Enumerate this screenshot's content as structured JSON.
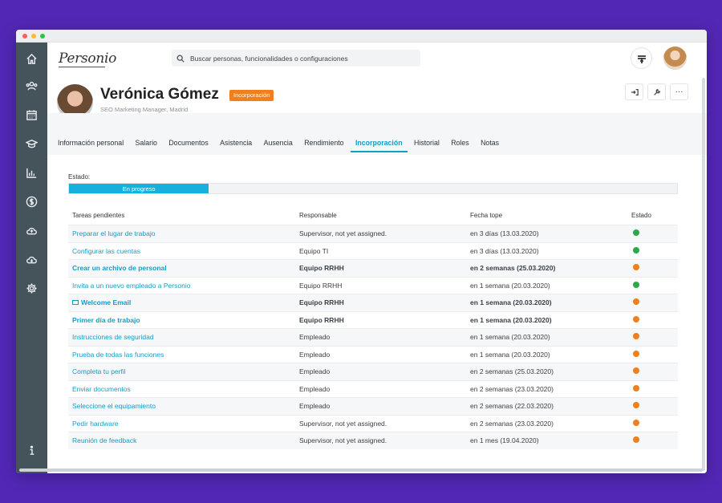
{
  "colors": {
    "background": "#5227b5",
    "sidebar": "#45535b",
    "accent": "#139ec6",
    "badge": "#f07f1e",
    "status_done": "#2aa84a",
    "status_pending": "#f07f1e"
  },
  "sidebar": {
    "items": [
      {
        "icon": "home-icon"
      },
      {
        "icon": "people-icon"
      },
      {
        "icon": "calendar-icon"
      },
      {
        "icon": "graduation-cap-icon"
      },
      {
        "icon": "bar-chart-icon"
      },
      {
        "icon": "dollar-icon"
      },
      {
        "icon": "cloud-upload-icon"
      },
      {
        "icon": "cloud-download-icon"
      },
      {
        "icon": "gear-icon"
      },
      {
        "icon": "info-icon"
      }
    ]
  },
  "header": {
    "logo": "Personio",
    "search_placeholder": "Buscar personas, funcionalidades o configuraciones"
  },
  "profile": {
    "name": "Verónica Gómez",
    "badge": "Incorporación",
    "subtitle": "SEO Marketing Manager, Madrid",
    "more_label": "···"
  },
  "tabs": [
    {
      "label": "Información personal",
      "active": false
    },
    {
      "label": "Salario",
      "active": false
    },
    {
      "label": "Documentos",
      "active": false
    },
    {
      "label": "Asistencia",
      "active": false
    },
    {
      "label": "Ausencia",
      "active": false
    },
    {
      "label": "Rendimiento",
      "active": false
    },
    {
      "label": "Incorporación",
      "active": true
    },
    {
      "label": "Historial",
      "active": false
    },
    {
      "label": "Roles",
      "active": false
    },
    {
      "label": "Notas",
      "active": false
    }
  ],
  "onboarding": {
    "estado_label": "Estado:",
    "progress_label": "En progreso",
    "progress_fraction": 0.23,
    "columns": [
      "Tareas pendientes",
      "Responsable",
      "Fecha tope",
      "Estado"
    ],
    "rows": [
      {
        "task": "Preparar el lugar de trabajo",
        "owner": "Supervisor, not yet assigned.",
        "due": "en 3 días (13.03.2020)",
        "status": "done",
        "bold": false,
        "icon": ""
      },
      {
        "task": "Configurar las cuentas",
        "owner": "Equipo TI",
        "due": "en 3 días (13.03.2020)",
        "status": "done",
        "bold": false,
        "icon": ""
      },
      {
        "task": "Crear un archivo de personal",
        "owner": "Equipo RRHH",
        "due": "en 2 semanas (25.03.2020)",
        "status": "pending",
        "bold": true,
        "icon": ""
      },
      {
        "task": "Invita a un nuevo empleado a Personio",
        "owner": "Equipo RRHH",
        "due": "en 1 semana (20.03.2020)",
        "status": "done",
        "bold": false,
        "icon": ""
      },
      {
        "task": "Welcome Email",
        "owner": "Equipo RRHH",
        "due": "en 1 semana (20.03.2020)",
        "status": "pending",
        "bold": true,
        "icon": "mail-icon"
      },
      {
        "task": "Primer día de trabajo",
        "owner": "Equipo RRHH",
        "due": "en 1 semana (20.03.2020)",
        "status": "pending",
        "bold": true,
        "icon": ""
      },
      {
        "task": "Instrucciones de seguridad",
        "owner": "Empleado",
        "due": "en 1 semana (20.03.2020)",
        "status": "pending",
        "bold": false,
        "icon": ""
      },
      {
        "task": "Prueba de todas las funciones",
        "owner": "Empleado",
        "due": "en 1 semana (20.03.2020)",
        "status": "pending",
        "bold": false,
        "icon": ""
      },
      {
        "task": "Completa tu perfil",
        "owner": "Empleado",
        "due": "en 2 semanas (25.03.2020)",
        "status": "pending",
        "bold": false,
        "icon": ""
      },
      {
        "task": "Enviar documentos",
        "owner": "Empleado",
        "due": "en 2 semanas (23.03.2020)",
        "status": "pending",
        "bold": false,
        "icon": ""
      },
      {
        "task": "Seleccione el equipamiento",
        "owner": "Empleado",
        "due": "en 2 semanas (22.03.2020)",
        "status": "pending",
        "bold": false,
        "icon": ""
      },
      {
        "task": "Pedir hardware",
        "owner": "Supervisor, not yet assigned.",
        "due": "en 2 semanas (23.03.2020)",
        "status": "pending",
        "bold": false,
        "icon": ""
      },
      {
        "task": "Reunión de feedback",
        "owner": "Supervisor, not yet assigned.",
        "due": "en 1 mes (19.04.2020)",
        "status": "pending",
        "bold": false,
        "icon": ""
      }
    ]
  }
}
